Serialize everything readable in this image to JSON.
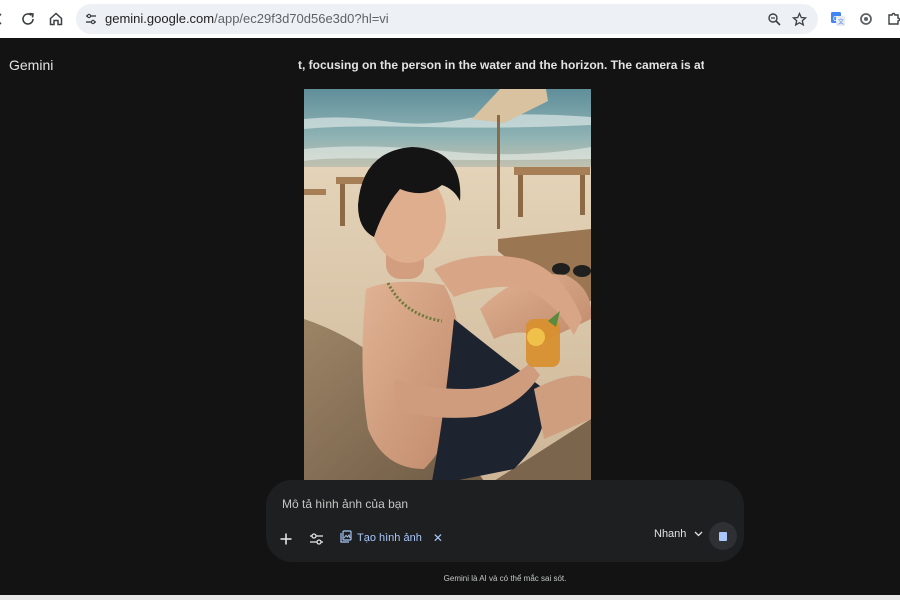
{
  "browser": {
    "url_host": "gemini.google.com",
    "url_path": "/app/ec29f3d70d56e3d0?hl=vi",
    "icons": [
      "back-icon",
      "reload-icon",
      "home-icon",
      "site-info-icon",
      "zoom-icon",
      "bookmark-star-icon",
      "google-translate-icon",
      "chrome-extension-icon",
      "extensions-puzzle-icon"
    ]
  },
  "app": {
    "brand": "Gemini",
    "prompt_excerpt": "t, focusing on the person in the water and the horizon. The camera is at water level, o"
  },
  "composer": {
    "placeholder": "Mô tả hình ảnh của bạn",
    "tool_chip_label": "Tạo hình ảnh",
    "model_label": "Nhanh",
    "icons": [
      "plus-icon",
      "tools-sliders-icon",
      "image-gen-icon",
      "close-icon",
      "chevron-down-icon",
      "stop-icon"
    ]
  },
  "footer": {
    "disclaimer": "Gemini là AI và có thể mắc sai sót."
  },
  "colors": {
    "background": "#131314",
    "card": "#1e1f20",
    "accent": "#a8c7fa",
    "text": "#e3e3e3"
  }
}
